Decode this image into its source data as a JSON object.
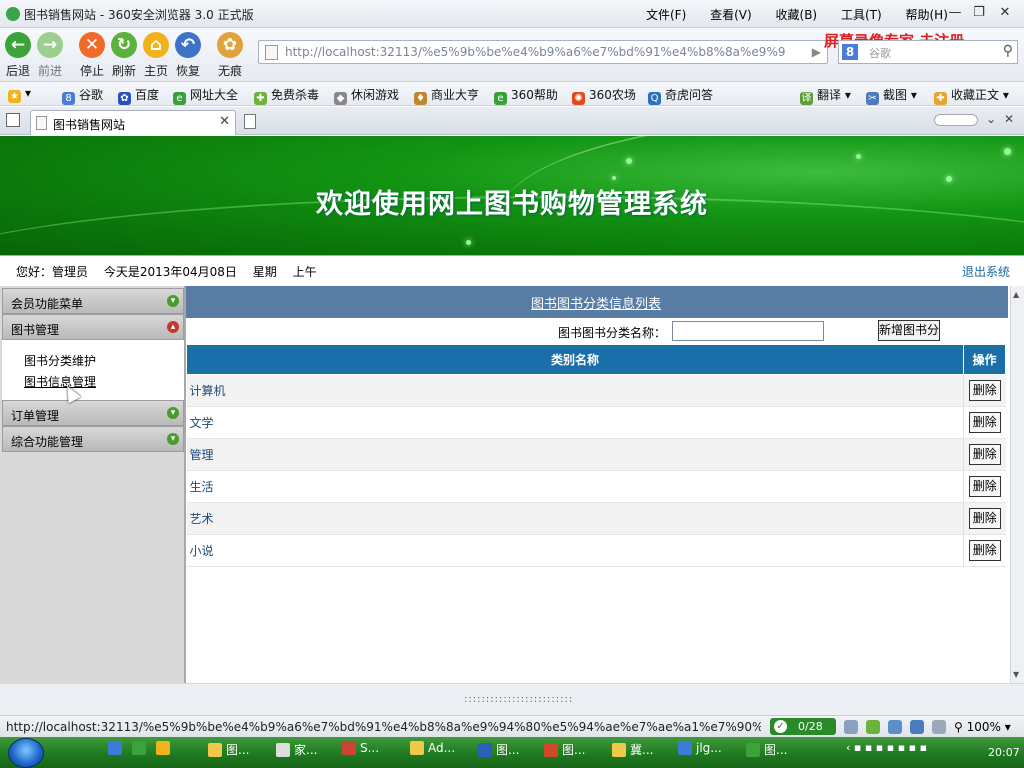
{
  "window": {
    "title": "图书销售网站 - 360安全浏览器 3.0 正式版",
    "menu": [
      "文件(F)",
      "查看(V)",
      "收藏(B)",
      "工具(T)",
      "帮助(H)"
    ]
  },
  "toolbar": {
    "back": "后退",
    "forward": "前进",
    "stop": "停止",
    "refresh": "刷新",
    "home": "主页",
    "restore": "恢复",
    "incognito": "无痕"
  },
  "address": {
    "url": "http://localhost:32113/%e5%9b%be%e4%b9%a6%e7%bd%91%e4%b8%8a%e9%94"
  },
  "watermark": "屏幕录像专家  未注册",
  "search": {
    "placeholder": "谷歌"
  },
  "favorites": [
    "谷歌",
    "百度",
    "网址大全",
    "免费杀毒",
    "休闲游戏",
    "商业大亨",
    "360帮助",
    "360农场",
    "奇虎问答"
  ],
  "favorites_right": [
    "翻译",
    "截图",
    "收藏正文"
  ],
  "tab": {
    "label": "图书销售网站"
  },
  "banner": {
    "title": "欢迎使用网上图书购物管理系统"
  },
  "info": {
    "greeting": "您好：管理员",
    "date": "今天是2013年04月08日",
    "weekday": "星期",
    "period": "上午",
    "logout": "退出系统"
  },
  "sidebar": {
    "sections": [
      {
        "label": "会员功能菜单"
      },
      {
        "label": "图书管理"
      },
      {
        "label": "订单管理"
      },
      {
        "label": "综合功能管理"
      }
    ],
    "subitems": [
      {
        "label": "图书分类维护"
      },
      {
        "label": "图书信息管理"
      }
    ]
  },
  "main": {
    "title": "图书图书分类信息列表",
    "filter_label": "图书图书分类名称：",
    "filter_value": "",
    "add_button": "新增图书分",
    "columns": [
      "类别名称",
      "操作"
    ],
    "delete_label": "删除",
    "rows": [
      {
        "name": "计算机"
      },
      {
        "name": "文学"
      },
      {
        "name": "管理"
      },
      {
        "name": "生活"
      },
      {
        "name": "艺术"
      },
      {
        "name": "小说"
      }
    ]
  },
  "status": {
    "url": "http://localhost:32113/%e5%9b%be%e4%b9%a6%e7%bd%91%e4%b8%8a%e9%94%80%e5%94%ae%e7%ae%a1%e7%90%8...",
    "counter": "0/28",
    "zoom": "100%"
  },
  "taskbar": {
    "items": [
      "图...",
      "家...",
      "S...",
      "Ad...",
      "图...",
      "图...",
      "冀...",
      "jlg...",
      "图..."
    ],
    "clock": "20:07"
  },
  "colors": {
    "banner_green": "#0b7a0b",
    "title_bar_blue": "#587ca4",
    "table_header_blue": "#1b6fa8",
    "link_blue": "#1a6aa0",
    "watermark_red": "#e02020"
  }
}
